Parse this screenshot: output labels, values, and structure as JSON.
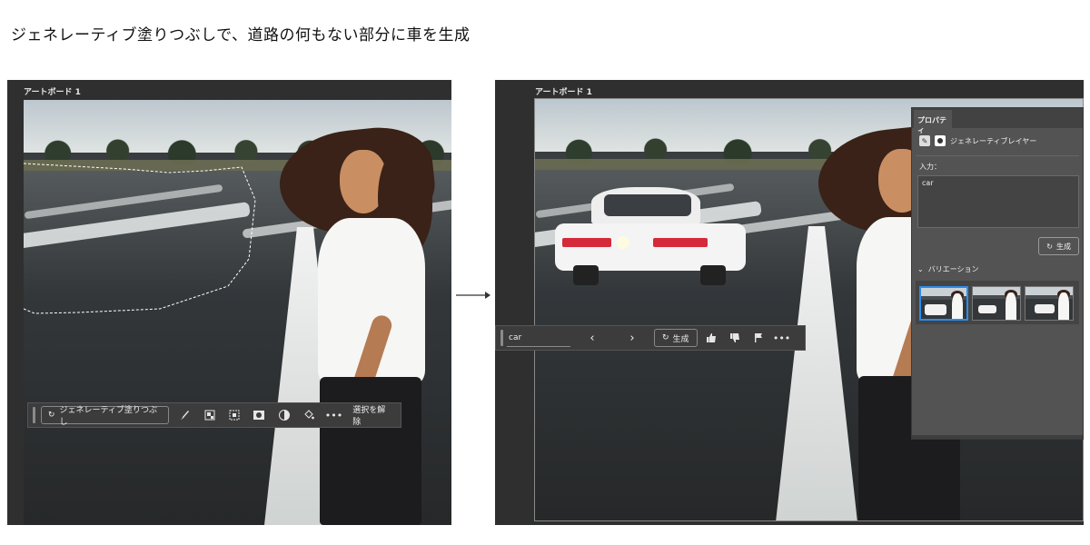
{
  "heading": "ジェネレーティブ塗りつぶしで、道路の何もない部分に車を生成",
  "left": {
    "artboard_label": "アートボード 1",
    "toolbar": {
      "gen_fill_label": "ジェネレーティブ塗りつぶし",
      "deselect_label": "選択を解除"
    }
  },
  "right": {
    "artboard_label": "アートボード 1",
    "prompt_bar": {
      "value": "car",
      "prev": "‹",
      "next": "›",
      "generate_label": "生成"
    },
    "properties": {
      "tab_label": "プロパティ",
      "layer_label": "ジェネレーティブレイヤー",
      "input_label": "入力：",
      "prompt_value": "car",
      "generate_label": "生成",
      "variations_label": "バリエーション"
    }
  },
  "arrow": "→"
}
